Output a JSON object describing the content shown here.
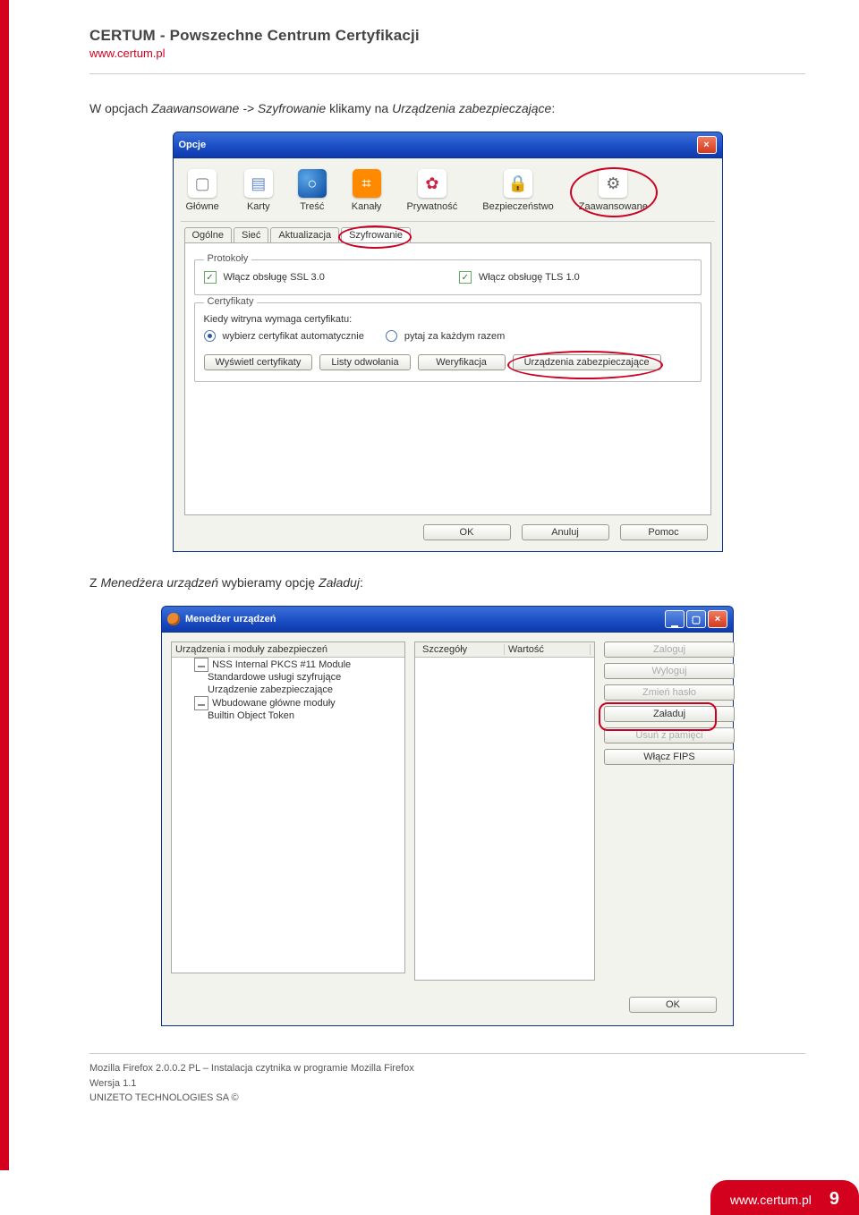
{
  "header": {
    "title": "CERTUM - Powszechne Centrum Certyfikacji",
    "url": "www.certum.pl"
  },
  "p1": {
    "pre": "W opcjach ",
    "i1": "Zaawansowane -> Szyfrowanie",
    "mid": " klikamy na ",
    "i2": "Urządzenia zabezpieczające",
    ":": ":"
  },
  "p2": {
    "pre": "Z ",
    "i1": "Menedżera urządzeń",
    "mid": " wybieramy opcję ",
    "i2": "Załaduj",
    ":": ":"
  },
  "opcje": {
    "title": "Opcje",
    "tabs": [
      "Główne",
      "Karty",
      "Treść",
      "Kanały",
      "Prywatność",
      "Bezpieczeństwo",
      "Zaawansowane"
    ],
    "subtabs": [
      "Ogólne",
      "Sieć",
      "Aktualizacja",
      "Szyfrowanie"
    ],
    "proto_legend": "Protokoły",
    "ssl": "Włącz obsługę SSL 3.0",
    "tls": "Włącz obsługę TLS 1.0",
    "cert_legend": "Certyfikaty",
    "cert_prompt": "Kiedy witryna wymaga certyfikatu:",
    "rad1": "wybierz certyfikat automatycznie",
    "rad2": "pytaj za każdym razem",
    "b_wys": "Wyświetl certyfikaty",
    "b_listy": "Listy odwołania",
    "b_wer": "Weryfikacja",
    "b_urz": "Urządzenia zabezpieczające",
    "ok": "OK",
    "anuluj": "Anuluj",
    "pomoc": "Pomoc"
  },
  "men": {
    "title": "Menedżer urządzeń",
    "tree_hd": "Urządzenia i moduły zabezpieczeń",
    "t1": "NSS Internal PKCS #11 Module",
    "t1a": "Standardowe usługi szyfrujące",
    "t1b": "Urządzenie zabezpieczające",
    "t2": "Wbudowane główne moduły",
    "t2a": "Builtin Object Token",
    "col1": "Szczegóły",
    "col2": "Wartość",
    "zaloguj": "Zaloguj",
    "wyloguj": "Wyloguj",
    "zmien": "Zmień hasło",
    "zaladuj": "Załaduj",
    "usun": "Usuń z pamięci",
    "fips": "Włącz FIPS",
    "ok": "OK"
  },
  "footer": {
    "l1": "Mozilla Firefox 2.0.0.2 PL – Instalacja czytnika w programie Mozilla Firefox",
    "l2": "Wersja 1.1",
    "l3": "UNIZETO TECHNOLOGIES SA ©"
  },
  "bottom": {
    "url": "www.certum.pl",
    "page": "9"
  }
}
